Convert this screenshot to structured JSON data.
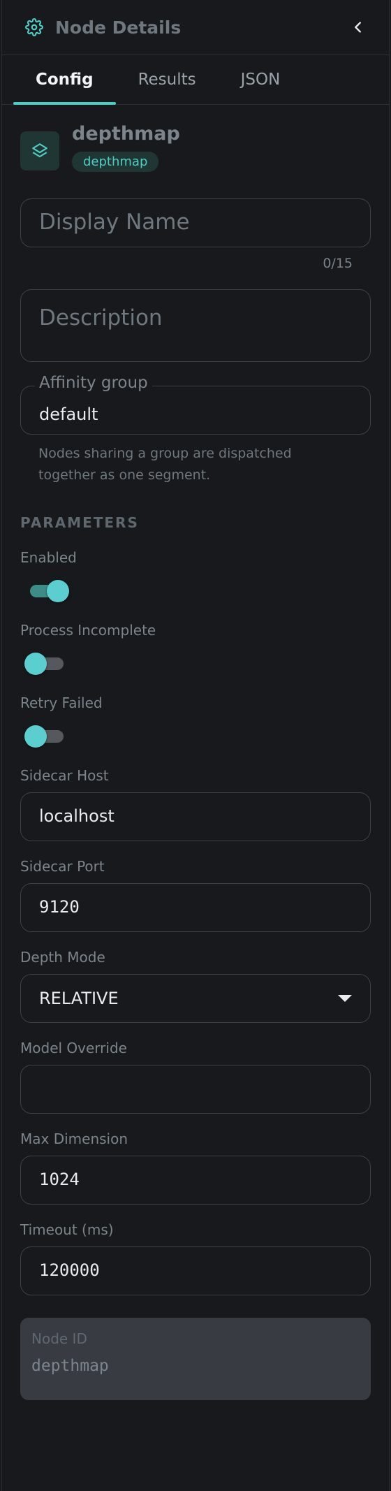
{
  "header": {
    "title": "Node Details",
    "settings_icon": "gear-icon",
    "back_icon": "chevron-left-icon"
  },
  "tabs": [
    {
      "label": "Config",
      "active": true
    },
    {
      "label": "Results",
      "active": false
    },
    {
      "label": "JSON",
      "active": false
    }
  ],
  "node": {
    "icon": "layers-icon",
    "name": "depthmap",
    "type_badge": "depthmap"
  },
  "display_name": {
    "placeholder": "Display Name",
    "value": "",
    "counter": "0/15"
  },
  "description": {
    "placeholder": "Description",
    "value": ""
  },
  "affinity": {
    "label": "Affinity group",
    "value": "default",
    "helper": "Nodes sharing a group are dispatched together as one segment."
  },
  "parameters": {
    "section_title": "PARAMETERS",
    "enabled": {
      "label": "Enabled",
      "on": true
    },
    "process_incomplete": {
      "label": "Process Incomplete",
      "on": false
    },
    "retry_failed": {
      "label": "Retry Failed",
      "on": false
    },
    "sidecar_host": {
      "label": "Sidecar Host",
      "value": "localhost"
    },
    "sidecar_port": {
      "label": "Sidecar Port",
      "value": "9120"
    },
    "depth_mode": {
      "label": "Depth Mode",
      "value": "RELATIVE"
    },
    "model_override": {
      "label": "Model Override",
      "value": ""
    },
    "max_dimension": {
      "label": "Max Dimension",
      "value": "1024"
    },
    "timeout": {
      "label": "Timeout (ms)",
      "value": "120000"
    }
  },
  "node_id": {
    "label": "Node ID",
    "value": "depthmap"
  },
  "colors": {
    "accent": "#4ecdc4",
    "background": "#17191c",
    "node_id_background": "#383c42"
  }
}
